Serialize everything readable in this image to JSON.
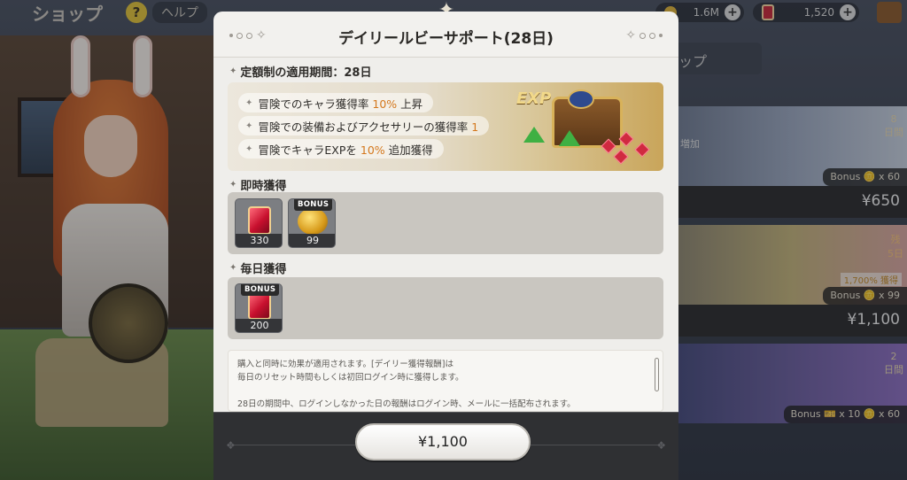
{
  "background": {
    "shop_title": "ショップ",
    "help_icon": "?",
    "help_label": "ヘルプ",
    "resources": [
      {
        "icon": "gold-coin-icon",
        "value": "1.6M"
      },
      {
        "icon": "ruby-gem-icon",
        "value": "1,520"
      }
    ],
    "right_tab": "ップ",
    "packs": [
      {
        "side": "8\n日間",
        "note": "増加",
        "bonus": "Bonus 🪙 x 60",
        "price": "¥650"
      },
      {
        "side": "残\n5日",
        "note": "1,700% 獲得",
        "bonus": "Bonus 🪙 x 99",
        "price": "¥1,100"
      },
      {
        "side": "2\n日間",
        "note": "",
        "bonus": "Bonus 🎫 x 10 🪙 x 60",
        "price": ""
      }
    ]
  },
  "modal": {
    "title": "デイリールビーサポート(28日)",
    "period_label": "定額制の適用期間：28日",
    "perks": [
      {
        "prefix": "冒険でのキャラ獲得率 ",
        "highlight": "10%",
        "suffix": " 上昇"
      },
      {
        "prefix": "冒険での装備およびアクセサリーの獲得率 ",
        "highlight": "1",
        "suffix": ""
      },
      {
        "prefix": "冒険でキャラEXPを ",
        "highlight": "10%",
        "suffix": " 追加獲得"
      }
    ],
    "banner_exp": "EXP",
    "instant_label": "即時獲得",
    "instant_items": [
      {
        "icon": "ruby-gem-icon",
        "qty": "330",
        "tag": ""
      },
      {
        "icon": "gold-pile-icon",
        "qty": "99",
        "tag": "BONUS"
      }
    ],
    "daily_label": "毎日獲得",
    "daily_items": [
      {
        "icon": "ruby-gem-icon",
        "qty": "200",
        "tag": "BONUS"
      }
    ],
    "notes": [
      "購入と同時に効果が適用されます。[デイリー獲得報酬]は",
      "毎日のリセット時間もしくは初回ログイン時に獲得します。",
      "",
      "28日の期間中、ログインしなかった日の報酬はログイン時、メールに一括配布されます。"
    ],
    "price_button": "¥1,100"
  },
  "colors": {
    "highlight": "#d4781e",
    "panel": "#c9c6c0",
    "footer": "#2f3033"
  }
}
